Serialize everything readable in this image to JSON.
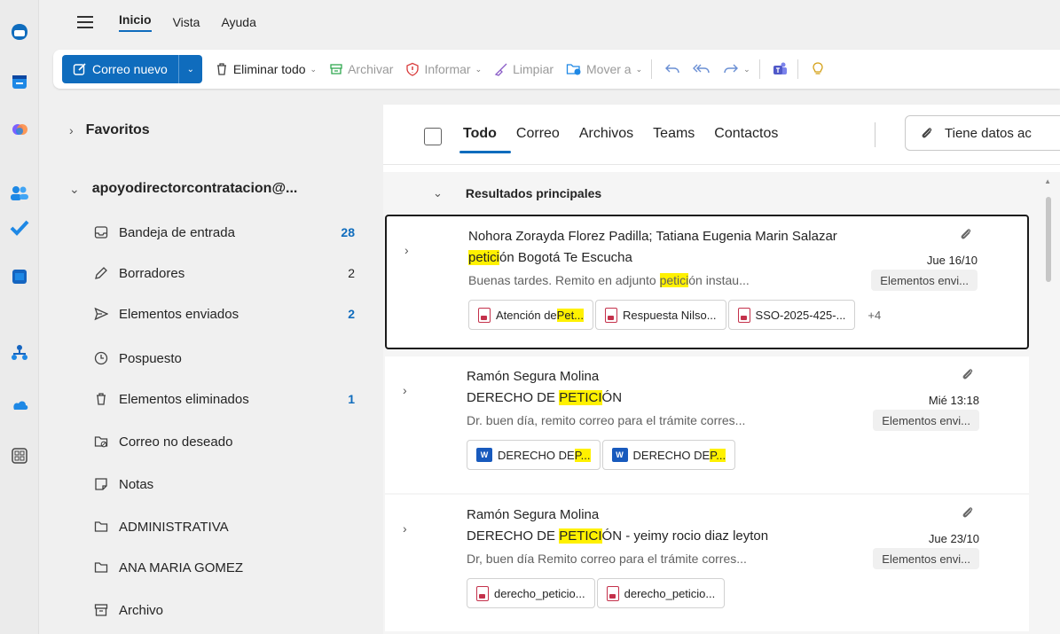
{
  "ribbon": {
    "tabs": [
      "Inicio",
      "Vista",
      "Ayuda"
    ]
  },
  "toolbar": {
    "new_mail": "Correo nuevo",
    "delete_all": "Eliminar todo",
    "archive": "Archivar",
    "report": "Informar",
    "sweep": "Limpiar",
    "move_to": "Mover a"
  },
  "sidebar": {
    "favorites": "Favoritos",
    "account": "apoyodirectorcontratacion@...",
    "folders": [
      {
        "label": "Bandeja de entrada",
        "count": "28",
        "icon": "inbox-icon"
      },
      {
        "label": "Borradores",
        "count": "2",
        "icon": "pencil-icon"
      },
      {
        "label": "Elementos enviados",
        "count": "2",
        "icon": "send-icon"
      },
      {
        "label": "Pospuesto",
        "count": "",
        "icon": "clock-icon"
      },
      {
        "label": "Elementos eliminados",
        "count": "1",
        "icon": "trash-icon"
      },
      {
        "label": "Correo no deseado",
        "count": "",
        "icon": "junk-icon"
      },
      {
        "label": "Notas",
        "count": "",
        "icon": "note-icon"
      },
      {
        "label": "ADMINISTRATIVA",
        "count": "",
        "icon": "folder-icon"
      },
      {
        "label": "ANA MARIA GOMEZ",
        "count": "",
        "icon": "folder-icon"
      },
      {
        "label": "Archivo",
        "count": "",
        "icon": "archive-icon"
      }
    ]
  },
  "filters": {
    "tabs": [
      "Todo",
      "Correo",
      "Archivos",
      "Teams",
      "Contactos"
    ],
    "has_attachments": "Tiene datos ac"
  },
  "results": {
    "heading": "Resultados principales",
    "messages": [
      {
        "sender": "Nohora Zorayda Florez Padilla; Tatiana Eugenia Marin Salazar",
        "subject_hl": "petici",
        "subject_post": "ón Bogotá Te Escucha",
        "date": "Jue 16/10",
        "preview_pre": "Buenas tardes. Remito en adjunto ",
        "preview_hl": "petici",
        "preview_post": "ón instau...",
        "folder": "Elementos envi...",
        "atts": [
          {
            "pre": "Atención de ",
            "hl": "Pet...",
            "post": "",
            "type": "pdf"
          },
          {
            "pre": "Respuesta Nilso...",
            "hl": "",
            "post": "",
            "type": "pdf"
          },
          {
            "pre": "SSO-2025-425-...",
            "hl": "",
            "post": "",
            "type": "pdf"
          }
        ],
        "more": "+4"
      },
      {
        "sender": "Ramón Segura Molina",
        "subject_pre": "DERECHO DE ",
        "subject_hl": "PETICI",
        "subject_post": "ÓN",
        "date": "Mié 13:18",
        "preview": "Dr. buen día, remito correo para el trámite corres...",
        "folder": "Elementos envi...",
        "atts": [
          {
            "pre": "DERECHO DE ",
            "hl": "P...",
            "type": "word"
          },
          {
            "pre": "DERECHO DE ",
            "hl": "P...",
            "type": "word"
          }
        ]
      },
      {
        "sender": "Ramón Segura Molina",
        "subject_pre": "DERECHO DE ",
        "subject_hl": "PETICI",
        "subject_post": "ÓN - yeimy rocio diaz leyton",
        "date": "Jue 23/10",
        "preview": "Dr, buen día Remito correo para el trámite corres...",
        "folder": "Elementos envi...",
        "atts": [
          {
            "pre": "derecho_peticio...",
            "type": "pdf"
          },
          {
            "pre": "derecho_peticio...",
            "type": "pdf"
          }
        ]
      }
    ]
  },
  "colors": {
    "accent": "#0f6cbd",
    "highlight": "#fff100"
  }
}
